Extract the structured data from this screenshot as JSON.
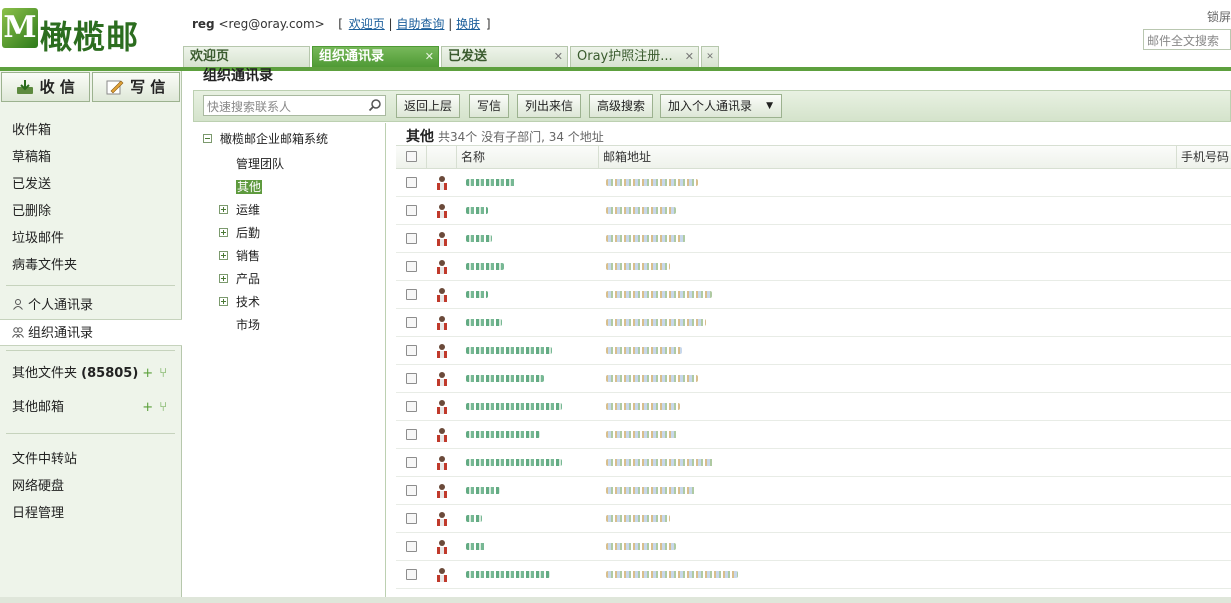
{
  "header": {
    "logo_text": "橄榄邮",
    "user_name": "reg",
    "user_email": "<reg@oray.com>",
    "links": [
      "欢迎页",
      "自助查询",
      "换肤"
    ],
    "lock_label": "锁屏",
    "mail_search_placeholder": "邮件全文搜索"
  },
  "tabs": [
    {
      "label": "欢迎页",
      "active": false,
      "closable": false
    },
    {
      "label": "组织通讯录",
      "active": true,
      "closable": true
    },
    {
      "label": "已发送",
      "active": false,
      "closable": true
    },
    {
      "label": "Oray护照注册...",
      "active": false,
      "closable": true
    }
  ],
  "sidebar": {
    "receive_label": "收 信",
    "compose_label": "写 信",
    "folders": [
      "收件箱",
      "草稿箱",
      "已发送",
      "已删除",
      "垃圾邮件",
      "病毒文件夹"
    ],
    "personal_contacts": "个人通讯录",
    "org_contacts": "组织通讯录",
    "other_folders_label": "其他文件夹",
    "other_folders_count": "(85805)",
    "other_mailbox_label": "其他邮箱",
    "tools": [
      "文件中转站",
      "网络硬盘",
      "日程管理"
    ]
  },
  "main": {
    "title": "组织通讯录",
    "search_placeholder": "快速搜索联系人",
    "buttons": {
      "back": "返回上层",
      "write": "写信",
      "list_incoming": "列出来信",
      "advanced_search": "高级搜索",
      "add_personal": "加入个人通讯录"
    },
    "tree": {
      "root": "橄榄邮企业邮箱系统",
      "nodes": [
        {
          "label": "管理团队",
          "expandable": false,
          "selected": false
        },
        {
          "label": "其他",
          "expandable": false,
          "selected": true
        },
        {
          "label": "运维",
          "expandable": true,
          "selected": false
        },
        {
          "label": "后勤",
          "expandable": true,
          "selected": false
        },
        {
          "label": "销售",
          "expandable": true,
          "selected": false
        },
        {
          "label": "产品",
          "expandable": true,
          "selected": false
        },
        {
          "label": "技术",
          "expandable": true,
          "selected": false
        },
        {
          "label": "市场",
          "expandable": false,
          "selected": false
        }
      ]
    },
    "group": {
      "name": "其他",
      "summary": "共34个 没有子部门, 34 个地址"
    },
    "columns": [
      "名称",
      "邮箱地址",
      "手机号码"
    ],
    "row_count_visible": 15
  },
  "colors": {
    "brand_green": "#5da03e",
    "active_tab": "#4f9a35",
    "sidebar_bg": "#eef4ea"
  }
}
